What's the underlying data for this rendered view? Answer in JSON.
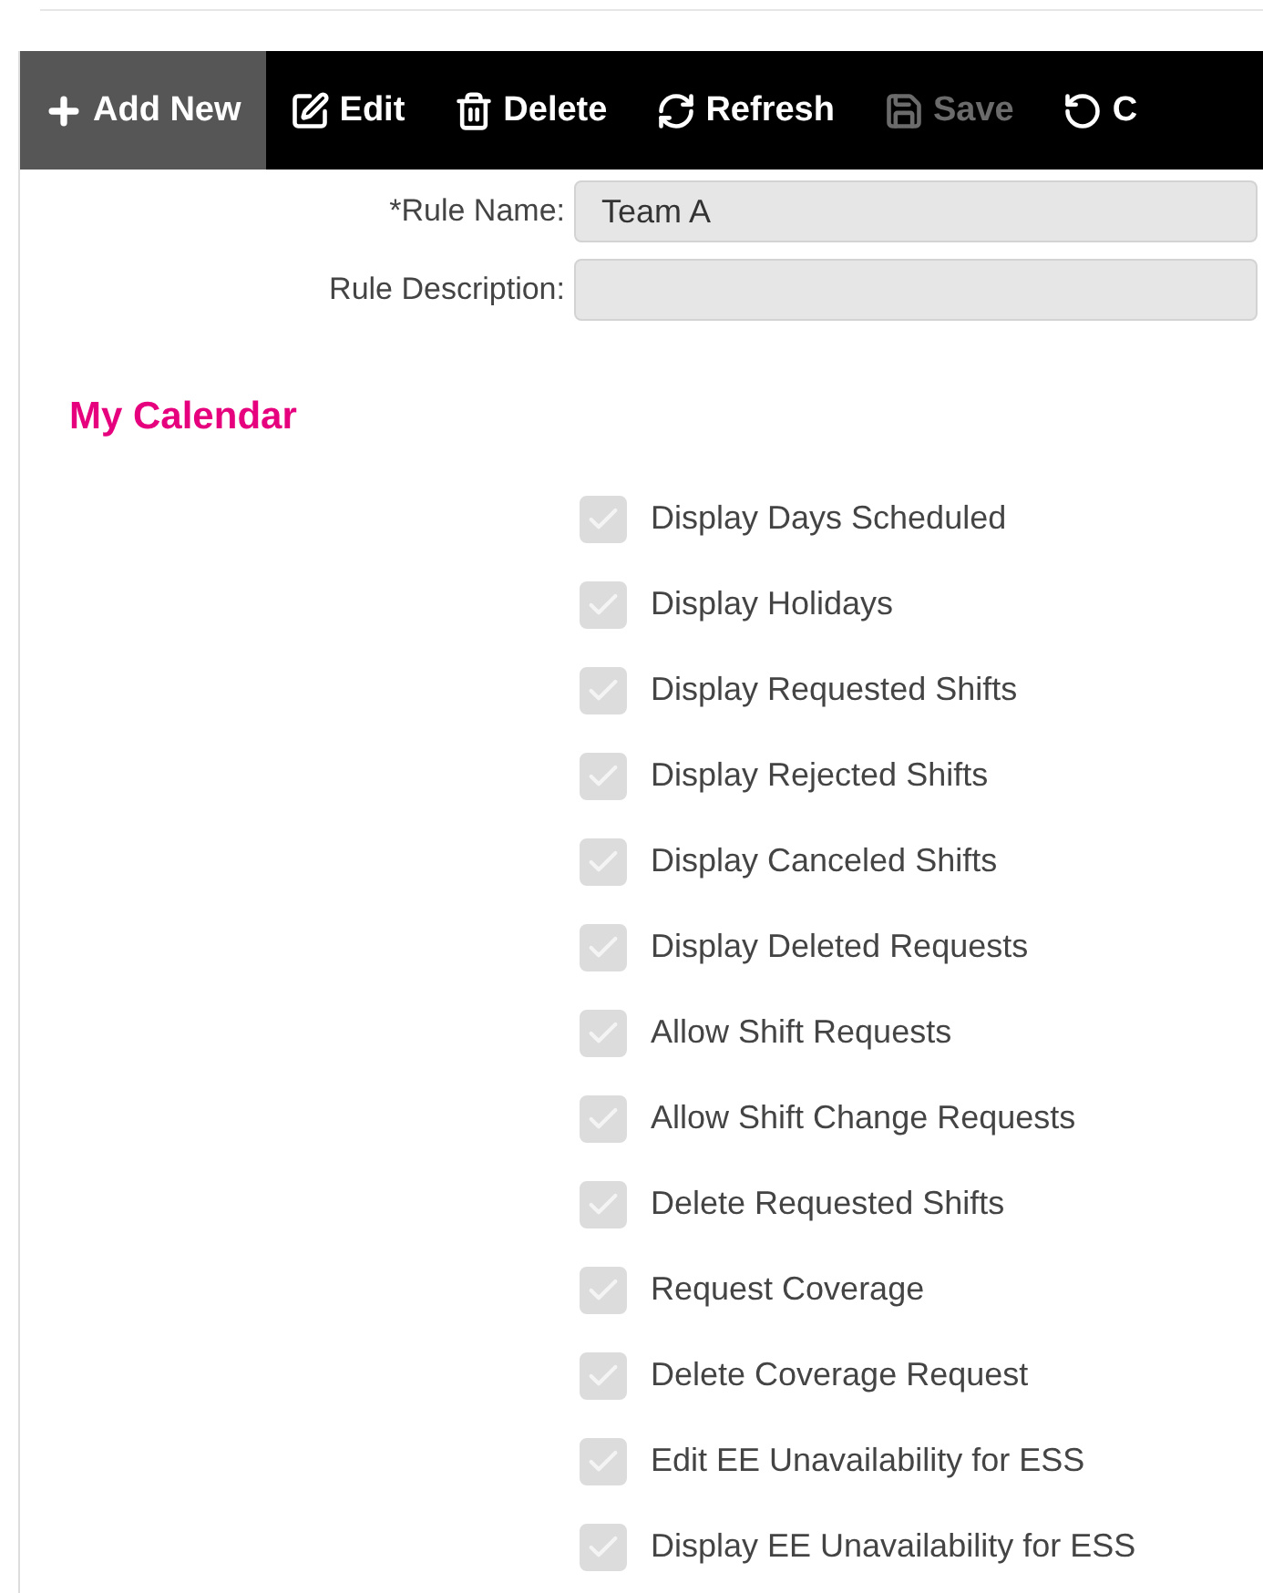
{
  "toolbar": [
    {
      "kind": "add",
      "label": "Add New",
      "selected": true,
      "disabled": false
    },
    {
      "kind": "edit",
      "label": "Edit",
      "selected": false,
      "disabled": false
    },
    {
      "kind": "delete",
      "label": "Delete",
      "selected": false,
      "disabled": false
    },
    {
      "kind": "refresh",
      "label": "Refresh",
      "selected": false,
      "disabled": false
    },
    {
      "kind": "save",
      "label": "Save",
      "selected": false,
      "disabled": true
    },
    {
      "kind": "cancel",
      "label": "C",
      "selected": false,
      "disabled": false
    }
  ],
  "fields": [
    {
      "label": "Rule Name:",
      "required": "*",
      "value": "Team A"
    },
    {
      "label": "Rule Description:"
    }
  ],
  "section_title": "My Calendar",
  "options": [
    {
      "label": "Display Days Scheduled",
      "checked": true,
      "disabled": true
    },
    {
      "label": "Display Holidays",
      "checked": true,
      "disabled": true
    },
    {
      "label": "Display Requested Shifts",
      "checked": true,
      "disabled": true
    },
    {
      "label": "Display Rejected Shifts",
      "checked": true,
      "disabled": true
    },
    {
      "label": "Display Canceled Shifts",
      "checked": true,
      "disabled": true
    },
    {
      "label": "Display Deleted Requests",
      "checked": true,
      "disabled": true
    },
    {
      "label": "Allow Shift Requests",
      "checked": true,
      "disabled": true
    },
    {
      "label": "Allow Shift Change Requests",
      "checked": true,
      "disabled": true
    },
    {
      "label": "Delete Requested Shifts",
      "checked": true,
      "disabled": true
    },
    {
      "label": "Request Coverage",
      "checked": true,
      "disabled": true
    },
    {
      "label": "Delete Coverage Request",
      "checked": true,
      "disabled": true
    },
    {
      "label": "Edit EE Unavailability for ESS",
      "checked": true,
      "disabled": true
    },
    {
      "label": "Display EE Unavailability for ESS",
      "checked": true,
      "disabled": true
    }
  ]
}
